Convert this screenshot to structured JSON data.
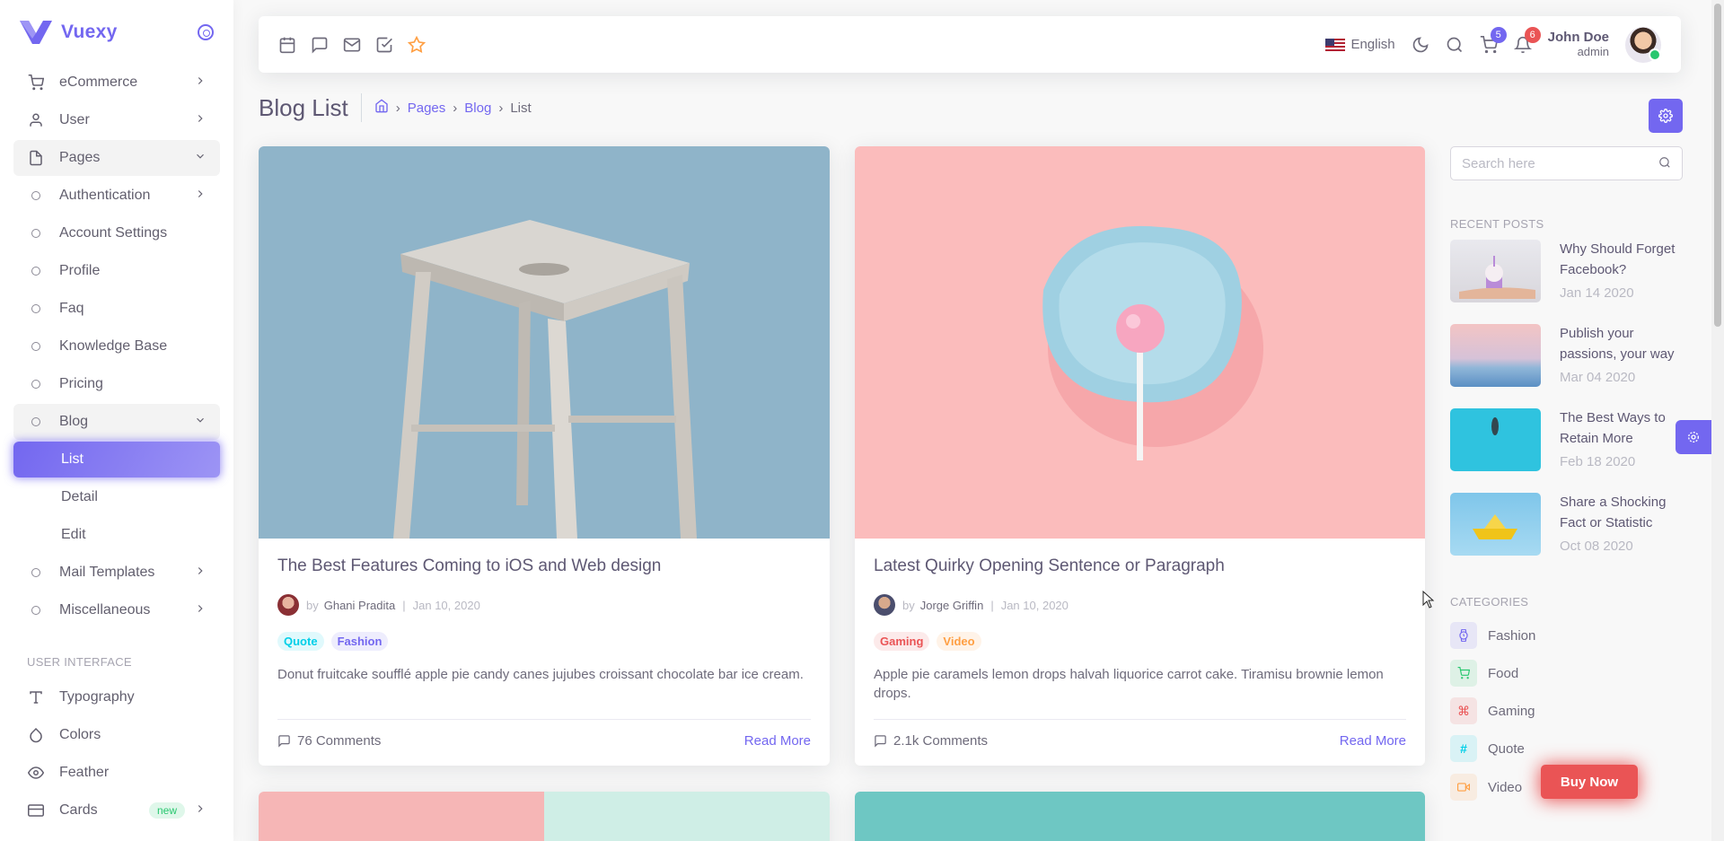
{
  "brand": {
    "name": "Vuexy"
  },
  "sidebar": {
    "items": [
      {
        "label": "eCommerce",
        "icon": "shopping-cart-icon"
      },
      {
        "label": "User",
        "icon": "user-icon"
      },
      {
        "label": "Pages",
        "icon": "file-icon"
      },
      {
        "label": "Authentication"
      },
      {
        "label": "Account Settings"
      },
      {
        "label": "Profile"
      },
      {
        "label": "Faq"
      },
      {
        "label": "Knowledge Base"
      },
      {
        "label": "Pricing"
      },
      {
        "label": "Blog"
      },
      {
        "label": "List"
      },
      {
        "label": "Detail"
      },
      {
        "label": "Edit"
      },
      {
        "label": "Mail Templates"
      },
      {
        "label": "Miscellaneous"
      }
    ],
    "section_ui": "USER INTERFACE",
    "ui_items": [
      {
        "label": "Typography",
        "icon": "type-icon"
      },
      {
        "label": "Colors",
        "icon": "droplet-icon"
      },
      {
        "label": "Feather",
        "icon": "eye-icon"
      },
      {
        "label": "Cards",
        "icon": "credit-card-icon",
        "badge": "new"
      }
    ]
  },
  "navbar": {
    "icons": [
      "calendar-icon",
      "message-square-icon",
      "mail-icon",
      "check-square-icon",
      "star-icon"
    ],
    "language": "English",
    "cart_count": "5",
    "notification_count": "6",
    "user_name": "John Doe",
    "user_role": "admin"
  },
  "header": {
    "title": "Blog List",
    "breadcrumb": [
      "Pages",
      "Blog",
      "List"
    ]
  },
  "posts": [
    {
      "title": "The Best Features Coming to iOS and Web design",
      "by": "by",
      "author": "Ghani Pradita",
      "date": "Jan 10, 2020",
      "tags": [
        "Quote",
        "Fashion"
      ],
      "text": "Donut fruitcake soufflé apple pie candy canes jujubes croissant chocolate bar ice cream.",
      "comments": "76 Comments",
      "read_more": "Read More"
    },
    {
      "title": "Latest Quirky Opening Sentence or Paragraph",
      "by": "by",
      "author": "Jorge Griffin",
      "date": "Jan 10, 2020",
      "tags": [
        "Gaming",
        "Video"
      ],
      "text": "Apple pie caramels lemon drops halvah liquorice carrot cake. Tiramisu brownie lemon drops.",
      "comments": "2.1k Comments",
      "read_more": "Read More"
    }
  ],
  "right": {
    "search_placeholder": "Search here",
    "recent_title": "RECENT POSTS",
    "recent": [
      {
        "title": "Why Should Forget Facebook?",
        "date": "Jan 14 2020"
      },
      {
        "title": "Publish your passions, your way",
        "date": "Mar 04 2020"
      },
      {
        "title": "The Best Ways to Retain More",
        "date": "Feb 18 2020"
      },
      {
        "title": "Share a Shocking Fact or Statistic",
        "date": "Oct 08 2020"
      }
    ],
    "categories_title": "CATEGORIES",
    "categories": [
      {
        "label": "Fashion",
        "icon": "watch-icon",
        "color": "#7367f0"
      },
      {
        "label": "Food",
        "icon": "shopping-cart-icon",
        "color": "#28c76f"
      },
      {
        "label": "Gaming",
        "icon": "command-icon",
        "color": "#ea5455"
      },
      {
        "label": "Quote",
        "icon": "hash-icon",
        "color": "#00cfe8"
      },
      {
        "label": "Video",
        "icon": "video-icon",
        "color": "#ff9f43"
      }
    ]
  },
  "buy_now": "Buy Now",
  "colors": {
    "primary": "#7367f0",
    "danger": "#ea5455",
    "success": "#28c76f",
    "info": "#00cfe8",
    "warning": "#ff9f43"
  }
}
